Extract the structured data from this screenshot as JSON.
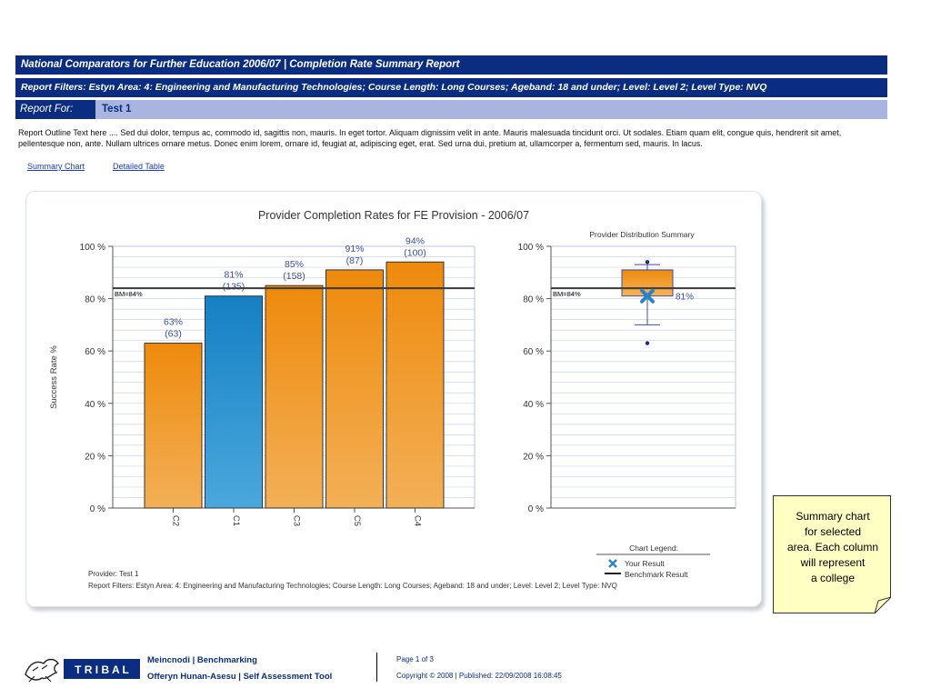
{
  "header": {
    "title": "National Comparators for Further Education 2006/07 | Completion Rate Summary Report",
    "filters": "Report Filters: Estyn Area: 4: Engineering and Manufacturing Technologies; Course Length: Long Courses; Ageband: 18 and under; Level: Level 2; Level Type: NVQ",
    "report_for_label": "Report For:",
    "report_for_value": "Test 1"
  },
  "outline_text": "Report Outline Text here .... Sed dui dolor, tempus ac, commodo id, sagittis non, mauris. In eget tortor. Aliquam dignissim velit in ante. Mauris malesuada tincidunt orci. Ut sodales. Etiam quam elit, congue quis, hendrerit sit amet, pellentesque non, ante. Nullam ultrices ornare metus. Donec enim lorem, ornare id, feugiat at, adipiscing eget, erat. Sed urna dui, pretium at, ullamcorper a, fermentum sed, mauris. In lacus.",
  "links": {
    "summary_chart": "Summary Chart",
    "detailed_table": "Detailed Table"
  },
  "chart_data": [
    {
      "type": "bar",
      "title": "Provider Completion Rates for FE Provision - 2006/07",
      "ylabel": "Success Rate %",
      "xlabel": "",
      "ylim": [
        0,
        100
      ],
      "yticks": [
        "0 %",
        "20 %",
        "40 %",
        "60 %",
        "80 %",
        "100 %"
      ],
      "categories": [
        "C2",
        "C1",
        "C3",
        "C5",
        "C4"
      ],
      "values": [
        63,
        81,
        85,
        91,
        94
      ],
      "counts": [
        63,
        135,
        158,
        87,
        100
      ],
      "value_labels": [
        "63%",
        "81%",
        "85%",
        "91%",
        "94%"
      ],
      "count_labels": [
        "(63)",
        "(135)",
        "(158)",
        "(87)",
        "(100)"
      ],
      "highlight_index": 1,
      "benchmark": 84,
      "benchmark_label": "BM=84%",
      "colors": {
        "bar": "#f0901a",
        "highlight": "#1e88c8",
        "benchmark": "#3a3a3a",
        "grid": "#c7d4ee"
      },
      "footer_provider": "Provider: Test 1",
      "footer_filters": "Report Filters:  Estyn Area:  4:  Engineering and Manufacturing Technologies;  Course Length:  Long Courses;  Ageband:  18 and under;  Level:  Level 2;  Level Type:  NVQ"
    },
    {
      "type": "box",
      "title": "Provider Distribution Summary",
      "ylim": [
        0,
        100
      ],
      "yticks": [
        "0 %",
        "20 %",
        "40 %",
        "60 %",
        "80 %",
        "100 %"
      ],
      "whisker_low": 70,
      "q1": 81,
      "q3": 91,
      "whisker_high": 93,
      "outliers": [
        94,
        63
      ],
      "your_result": 81,
      "your_result_label": "81%",
      "benchmark": 84,
      "benchmark_label": "BM=84%",
      "legend": {
        "title": "Chart Legend:",
        "your_result": "Your Result",
        "benchmark_result": "Benchmark Result"
      }
    }
  ],
  "note": {
    "text_lines": [
      "Summary chart",
      "for selected",
      "area. Each column",
      "will represent",
      "a college"
    ]
  },
  "footer": {
    "logo_text": "T R I B A L",
    "line1": "Meincnodi | Benchmarking",
    "line2": "Offeryn Hunan-Asesu | Self Assessment Tool",
    "page": "Page 1 of 3",
    "copyright": "Copyright © 2008 | Published: 22/09/2008 16:08:45"
  }
}
